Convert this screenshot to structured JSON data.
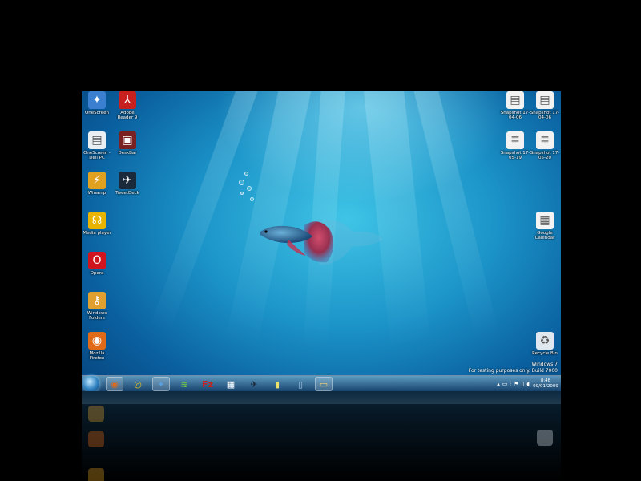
{
  "desktop_icons_left": [
    {
      "label": "OneScreen",
      "icon": "network-icon",
      "color": "#3a7fd0",
      "glyph": "✦"
    },
    {
      "label": "Adobe Reader 9",
      "icon": "pdf-icon",
      "color": "#c8201e",
      "glyph": "⅄"
    },
    {
      "label": "OneScreen - Dell PC",
      "icon": "document-icon",
      "color": "#e9eef2",
      "glyph": "▤"
    },
    {
      "label": "DeskBar",
      "icon": "app-icon",
      "color": "#7a2222",
      "glyph": "▣"
    },
    {
      "label": "Winamp",
      "icon": "winamp-icon",
      "color": "#e0a020",
      "glyph": "⚡"
    },
    {
      "label": "TweetDeck",
      "icon": "bird-icon",
      "color": "#1a2a3a",
      "glyph": "✈"
    },
    {
      "label": "Media player",
      "icon": "headphones-icon",
      "color": "#e8b400",
      "glyph": "☊"
    },
    {
      "label": "Opera",
      "icon": "opera-icon",
      "color": "#d0141e",
      "glyph": "O"
    },
    {
      "label": "Windows Folders",
      "icon": "keys-icon",
      "color": "#e0a030",
      "glyph": "⚷"
    },
    {
      "label": "Mozilla Firefox",
      "icon": "firefox-icon",
      "color": "#e06a18",
      "glyph": "◉"
    }
  ],
  "desktop_icons_right": [
    {
      "label": "Snapshot 17-04-06",
      "icon": "file-icon",
      "color": "#f2f2f2",
      "glyph": "▤"
    },
    {
      "label": "Snapshot 17-04-06",
      "icon": "file-icon",
      "color": "#f2f2f2",
      "glyph": "▤"
    },
    {
      "label": "Snapshot 17-05-19",
      "icon": "text-file-icon",
      "color": "#f2f2f2",
      "glyph": "≣"
    },
    {
      "label": "Snapshot 17-05-20",
      "icon": "text-file-icon",
      "color": "#f2f2f2",
      "glyph": "≣"
    },
    {
      "label": "Google Calendar",
      "icon": "calendar-icon",
      "color": "#f4f4f4",
      "glyph": "▦"
    },
    {
      "label": "Recycle Bin",
      "icon": "recycle-bin-icon",
      "color": "#dfe8ee",
      "glyph": "♻"
    }
  ],
  "watermark": {
    "line1": "Windows 7",
    "line2": "For testing purposes only. Build 7000"
  },
  "taskbar": {
    "items": [
      {
        "name": "firefox-taskbar-button",
        "icon": "firefox-icon",
        "color": "#e06a18",
        "glyph": "◉",
        "active": true
      },
      {
        "name": "chrome-taskbar-button",
        "icon": "chrome-icon",
        "color": "#e8c020",
        "glyph": "◎",
        "active": false
      },
      {
        "name": "network-taskbar-button",
        "icon": "network-icon",
        "color": "#5aa0e0",
        "glyph": "✦",
        "active": true
      },
      {
        "name": "spotify-taskbar-button",
        "icon": "spotify-icon",
        "color": "#6cc04a",
        "glyph": "≋",
        "active": false
      },
      {
        "name": "filezilla-taskbar-button",
        "icon": "filezilla-icon",
        "color": "#c8201e",
        "glyph": "Fz",
        "active": false
      },
      {
        "name": "tiles-taskbar-button",
        "icon": "tiles-icon",
        "color": "#ffffff",
        "glyph": "▦",
        "active": false
      },
      {
        "name": "tweetdeck-taskbar-button",
        "icon": "bird-icon",
        "color": "#1a2a3a",
        "glyph": "✈",
        "active": false
      },
      {
        "name": "notes-taskbar-button",
        "icon": "notes-icon",
        "color": "#f0e070",
        "glyph": "▮",
        "active": false
      },
      {
        "name": "app-taskbar-button",
        "icon": "app-icon",
        "color": "#a0c0e0",
        "glyph": "▯",
        "active": false
      },
      {
        "name": "explorer-taskbar-button",
        "icon": "folder-icon",
        "color": "#f0d070",
        "glyph": "▭",
        "active": true
      }
    ],
    "tray_icons": [
      "chevron-up-icon",
      "monitor-icon",
      "signal-icon",
      "flag-icon",
      "battery-icon",
      "volume-icon"
    ],
    "clock_time": "8:48",
    "clock_date": "09/01/2009"
  }
}
